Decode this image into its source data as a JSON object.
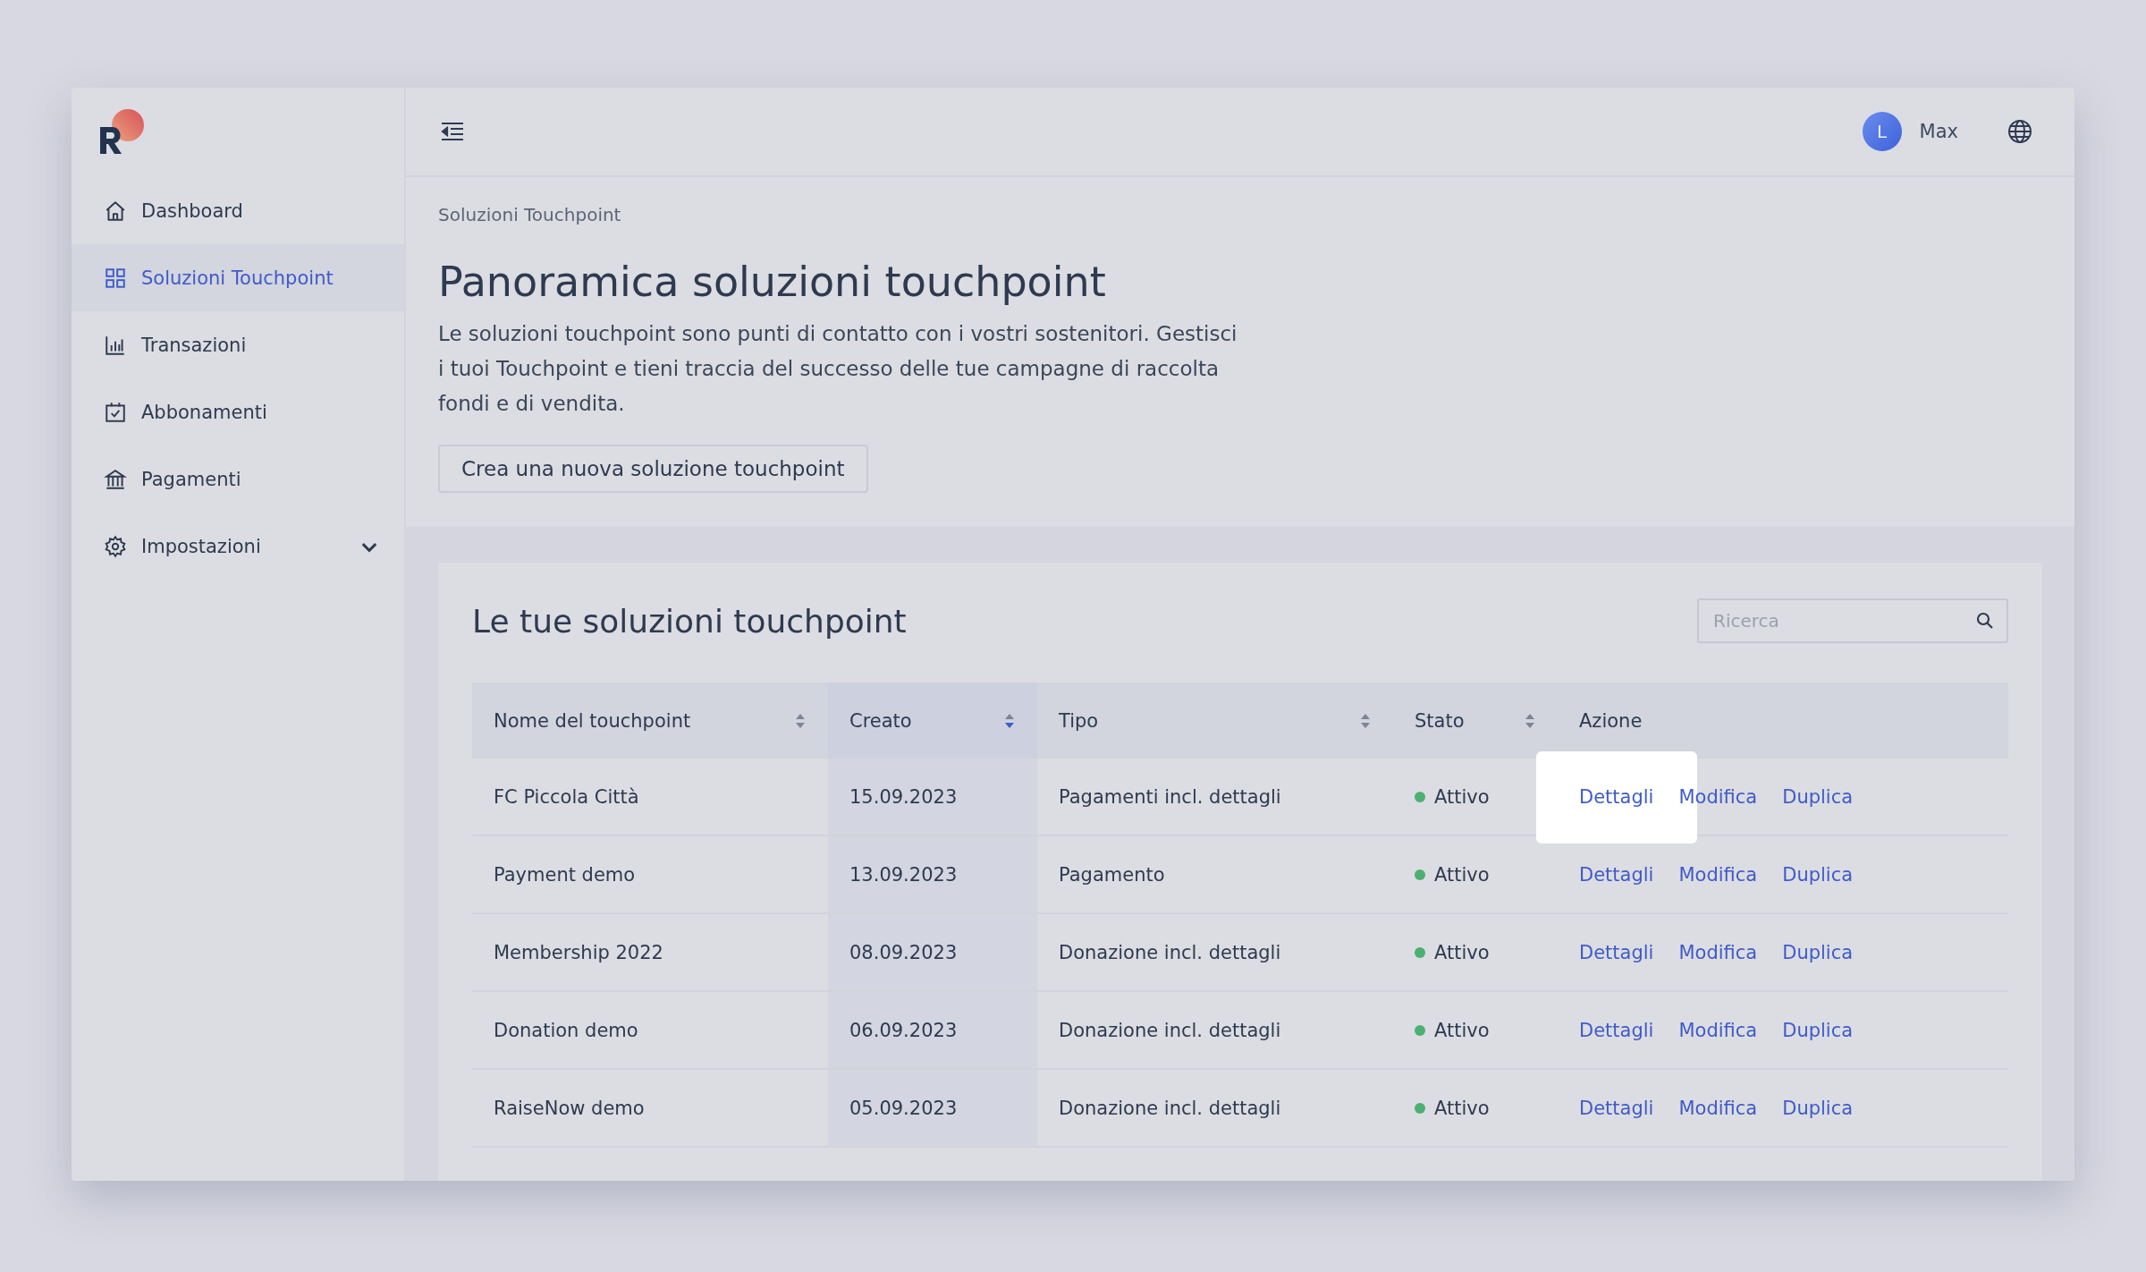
{
  "sidebar": {
    "items": [
      {
        "label": "Dashboard",
        "selected": false
      },
      {
        "label": "Soluzioni Touchpoint",
        "selected": true
      },
      {
        "label": "Transazioni",
        "selected": false
      },
      {
        "label": "Abbonamenti",
        "selected": false
      },
      {
        "label": "Pagamenti",
        "selected": false
      },
      {
        "label": "Impostazioni",
        "selected": false,
        "expanded": false
      }
    ]
  },
  "header": {
    "avatar_initial": "L",
    "user_name": "Max"
  },
  "breadcrumb": "Soluzioni Touchpoint",
  "title": "Panoramica soluzioni touchpoint",
  "description": "Le soluzioni touchpoint sono punti di contatto con i vostri sostenitori. Gestisci i tuoi Touchpoint e tieni traccia del successo delle tue campagne di raccolta fondi e di vendita.",
  "create_button": "Crea una nuova soluzione touchpoint",
  "table_card": {
    "title": "Le tue soluzioni touchpoint",
    "search": {
      "placeholder": "Ricerca"
    },
    "columns": [
      {
        "label": "Nome del touchpoint",
        "sortable": true,
        "sorted": false
      },
      {
        "label": "Creato",
        "sortable": true,
        "sorted": true
      },
      {
        "label": "Tipo",
        "sortable": true,
        "sorted": false
      },
      {
        "label": "Stato",
        "sortable": true,
        "sorted": false
      },
      {
        "label": "Azione",
        "sortable": false
      }
    ],
    "rows": [
      {
        "name": "FC Piccola Città",
        "created": "15.09.2023",
        "type": "Pagamenti incl. dettagli",
        "status": "Attivo",
        "color": "#4caf73",
        "actions": [
          "Dettagli",
          "Modifica",
          "Duplica"
        ],
        "highlighted": true
      },
      {
        "name": "Payment demo",
        "created": "13.09.2023",
        "type": "Pagamento",
        "status": "Attivo",
        "color": "#4caf73",
        "actions": [
          "Dettagli",
          "Modifica",
          "Duplica"
        ],
        "highlighted": false
      },
      {
        "name": "Membership 2022",
        "created": "08.09.2023",
        "type": "Donazione incl. dettagli",
        "status": "Attivo",
        "color": "#4caf73",
        "actions": [
          "Dettagli",
          "Modifica",
          "Duplica"
        ],
        "highlighted": false
      },
      {
        "name": "Donation demo",
        "created": "06.09.2023",
        "type": "Donazione incl. dettagli",
        "status": "Attivo",
        "color": "#4caf73",
        "actions": [
          "Dettagli",
          "Modifica",
          "Duplica"
        ],
        "highlighted": false
      },
      {
        "name": "RaiseNow demo",
        "created": "05.09.2023",
        "type": "Donazione incl. dettagli",
        "status": "Attivo",
        "color": "#4caf73",
        "actions": [
          "Dettagli",
          "Modifica",
          "Duplica"
        ],
        "highlighted": false
      }
    ]
  }
}
